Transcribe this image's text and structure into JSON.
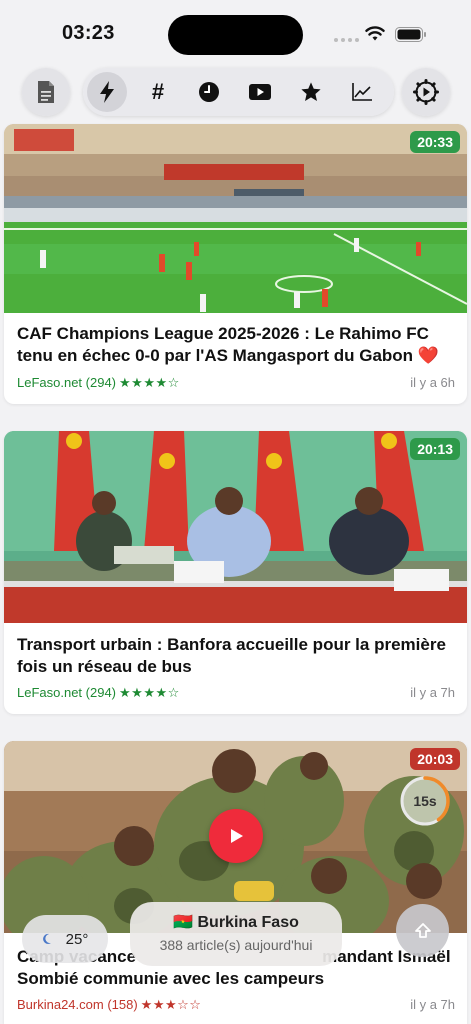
{
  "status": {
    "time": "03:23"
  },
  "toolbar": {
    "tabs": [
      "bolt-icon",
      "hash-icon",
      "clock-icon",
      "video-icon",
      "star-icon",
      "chart-icon"
    ],
    "hash_label": "#",
    "active": "bolt-icon"
  },
  "cards": [
    {
      "badge": "20:33",
      "title": "CAF Champions League 2025-2026 : Le Rahimo FC tenu en échec 0-0 par l'AS Mangasport du Gabon ❤️",
      "source": "LeFaso.net (294)",
      "stars": "★★★★☆",
      "rating": 4,
      "ago": "il y a 6h"
    },
    {
      "badge": "20:13",
      "title": "Transport urbain : Banfora accueille pour la première fois un réseau de bus",
      "source": "LeFaso.net (294)",
      "stars": "★★★★☆",
      "rating": 4,
      "ago": "il y a 7h"
    },
    {
      "badge": "20:03",
      "timer": "15s",
      "timer_progress": 0.4,
      "title": "Camp vacances : le Commandant Ismaël Sombié communie avec les campeurs",
      "title_line1_left": "Camp vacance",
      "title_line1_right": "mandant Ismaël",
      "title_line2": "Sombié communie avec les campeurs",
      "source": "Burkina24.com (158)",
      "stars": "★★★☆☆",
      "rating": 3,
      "ago": "il y a 7h"
    }
  ],
  "weather": {
    "icon": "moon-icon",
    "temp": "25°"
  },
  "country": {
    "flag": "🇧🇫",
    "name": "Burkina Faso",
    "count": "388 article(s) aujourd'hui"
  },
  "colors": {
    "green": "#2e9a4a",
    "red": "#c0352b",
    "play": "#ef2b3b"
  }
}
